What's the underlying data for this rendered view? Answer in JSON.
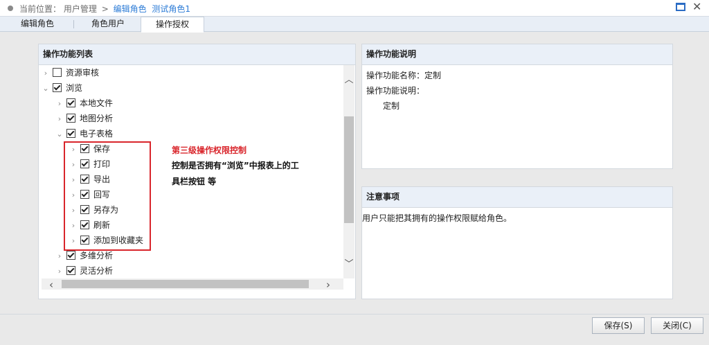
{
  "breadcrumb": {
    "prefix": "当前位置：",
    "items": [
      "用户管理",
      "编辑角色",
      "测试角色1"
    ],
    "sep": ">"
  },
  "tabs": [
    {
      "label": "编辑角色"
    },
    {
      "label": "角色用户"
    },
    {
      "label": "操作授权",
      "active": true
    }
  ],
  "left_panel": {
    "title": "操作功能列表",
    "tree": [
      {
        "label": "资源审核",
        "checked": false,
        "level": 0
      },
      {
        "label": "浏览",
        "checked": true,
        "level": 0,
        "expanded": true
      },
      {
        "label": "本地文件",
        "checked": true,
        "level": 1
      },
      {
        "label": "地图分析",
        "checked": true,
        "level": 1
      },
      {
        "label": "电子表格",
        "checked": true,
        "level": 1,
        "expanded": true
      },
      {
        "label": "保存",
        "checked": true,
        "level": 2
      },
      {
        "label": "打印",
        "checked": true,
        "level": 2
      },
      {
        "label": "导出",
        "checked": true,
        "level": 2
      },
      {
        "label": "回写",
        "checked": true,
        "level": 2
      },
      {
        "label": "另存为",
        "checked": true,
        "level": 2
      },
      {
        "label": "刷新",
        "checked": true,
        "level": 2
      },
      {
        "label": "添加到收藏夹",
        "checked": true,
        "level": 2
      },
      {
        "label": "多维分析",
        "checked": true,
        "level": 1
      },
      {
        "label": "灵活分析",
        "checked": true,
        "level": 1
      }
    ]
  },
  "annotation": {
    "title": "第三级操作权限控制",
    "line1": "控制是否拥有“浏览”中报表上的工",
    "line2": "具栏按钮 等"
  },
  "right_top": {
    "title": "操作功能说明",
    "name_line": "操作功能名称：定制",
    "desc_label": "操作功能说明：",
    "desc_value": "定制"
  },
  "right_bottom": {
    "title": "注意事项",
    "text": "用户只能把其拥有的操作权限赋给角色。"
  },
  "footer": {
    "save": "保存(S)",
    "close": "关闭(C)"
  },
  "colors": {
    "accent": "#2b7bd6",
    "highlight": "#d9252b"
  }
}
